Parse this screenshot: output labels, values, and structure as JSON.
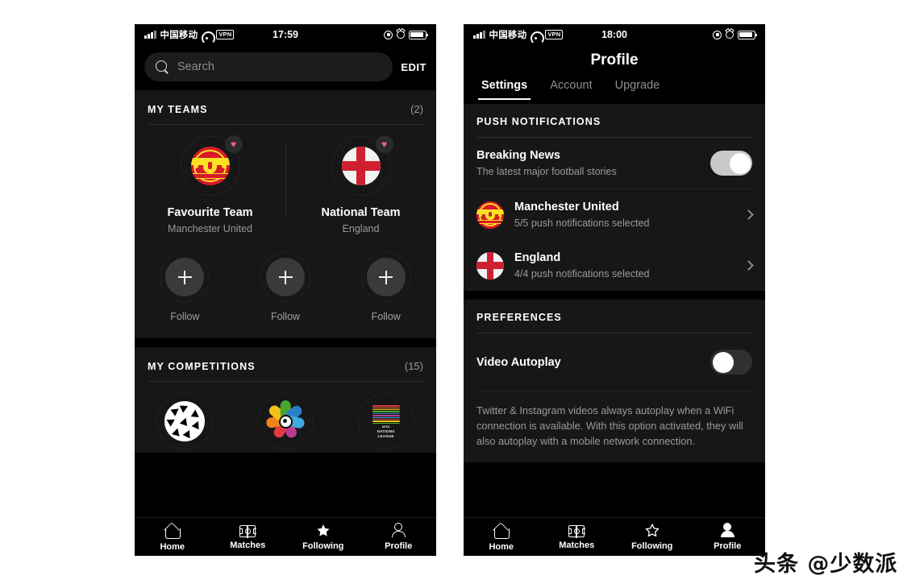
{
  "left_phone": {
    "statusbar": {
      "carrier": "中国移动",
      "vpn": "VPN",
      "time": "17:59"
    },
    "search": {
      "placeholder": "Search",
      "edit_label": "EDIT"
    },
    "my_teams": {
      "title": "MY TEAMS",
      "count": "(2)",
      "teams": [
        {
          "label": "Favourite Team",
          "name": "Manchester United",
          "crest": "manchester-united-crest",
          "heart": "♥"
        },
        {
          "label": "National Team",
          "name": "England",
          "crest": "england-flag-crest",
          "heart": "♥"
        }
      ],
      "follow_slots": [
        {
          "label": "Follow",
          "icon": "plus-icon"
        },
        {
          "label": "Follow",
          "icon": "plus-icon"
        },
        {
          "label": "Follow",
          "icon": "plus-icon"
        }
      ]
    },
    "my_competitions": {
      "title": "MY COMPETITIONS",
      "count": "(15)",
      "competitions": [
        {
          "name": "UEFA Champions League",
          "logo": "champions-league-starball-logo"
        },
        {
          "name": "LaLiga",
          "logo": "laliga-logo"
        },
        {
          "name": "UEFA Nations League",
          "logo": "uefa-nations-league-logo",
          "text_top": "UEFA",
          "text_main": "NATIONS",
          "text_sub": "LEAGUE"
        }
      ]
    },
    "tabbar": {
      "tabs": [
        {
          "label": "Home",
          "icon": "home-icon",
          "active": false
        },
        {
          "label": "Matches",
          "icon": "pitch-icon",
          "active": false
        },
        {
          "label": "Following",
          "icon": "star-filled-icon",
          "active": true
        },
        {
          "label": "Profile",
          "icon": "person-outline-icon",
          "active": false
        }
      ]
    }
  },
  "right_phone": {
    "statusbar": {
      "carrier": "中国移动",
      "vpn": "VPN",
      "time": "18:00"
    },
    "nav_title": "Profile",
    "segments": [
      {
        "label": "Settings",
        "active": true
      },
      {
        "label": "Account",
        "active": false
      },
      {
        "label": "Upgrade",
        "active": false
      }
    ],
    "push_notifications": {
      "title": "PUSH NOTIFICATIONS",
      "breaking_news": {
        "title": "Breaking News",
        "subtitle": "The latest major football stories",
        "toggle_state": "on"
      },
      "teams": [
        {
          "name": "Manchester United",
          "detail": "5/5 push notifications selected",
          "crest": "manchester-united-crest"
        },
        {
          "name": "England",
          "detail": "4/4 push notifications selected",
          "crest": "england-flag-crest"
        }
      ]
    },
    "preferences": {
      "title": "PREFERENCES",
      "video_autoplay": {
        "title": "Video Autoplay",
        "toggle_state": "off"
      },
      "note": "Twitter & Instagram videos always autoplay when a WiFi connection is available. With this option activated, they will also autoplay with a mobile network connection."
    },
    "tabbar": {
      "tabs": [
        {
          "label": "Home",
          "icon": "home-icon",
          "active": false
        },
        {
          "label": "Matches",
          "icon": "pitch-icon",
          "active": false
        },
        {
          "label": "Following",
          "icon": "star-outline-icon",
          "active": false
        },
        {
          "label": "Profile",
          "icon": "person-filled-icon",
          "active": true
        }
      ]
    }
  },
  "watermark": {
    "text": "头条 @少数派"
  },
  "colors": {
    "page_background": "#ffffff",
    "phone_background": "#000000",
    "card_background": "#171717",
    "accent_heart": "#f0609a",
    "toggle_on": "#c9c9c9",
    "toggle_off": "#303030",
    "muted_text": "#9a9a9a"
  }
}
